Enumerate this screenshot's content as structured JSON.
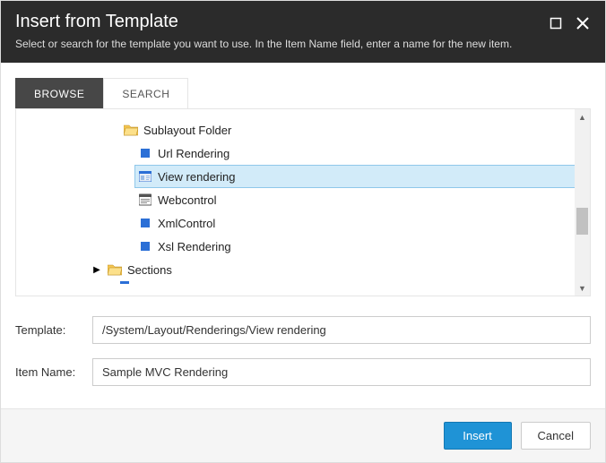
{
  "header": {
    "title": "Insert from Template",
    "subtitle": "Select or search for the template you want to use. In the Item Name field, enter a name for the new item."
  },
  "tabs": {
    "browse": "BROWSE",
    "search": "SEARCH"
  },
  "tree": {
    "sublayout_folder": "Sublayout Folder",
    "url_rendering": "Url Rendering",
    "view_rendering": "View rendering",
    "webcontrol": "Webcontrol",
    "xmlcontrol": "XmlControl",
    "xsl_rendering": "Xsl Rendering",
    "sections": "Sections"
  },
  "form": {
    "template_label": "Template:",
    "template_value": "/System/Layout/Renderings/View rendering",
    "itemname_label": "Item Name:",
    "itemname_value": "Sample MVC Rendering"
  },
  "footer": {
    "insert": "Insert",
    "cancel": "Cancel"
  }
}
